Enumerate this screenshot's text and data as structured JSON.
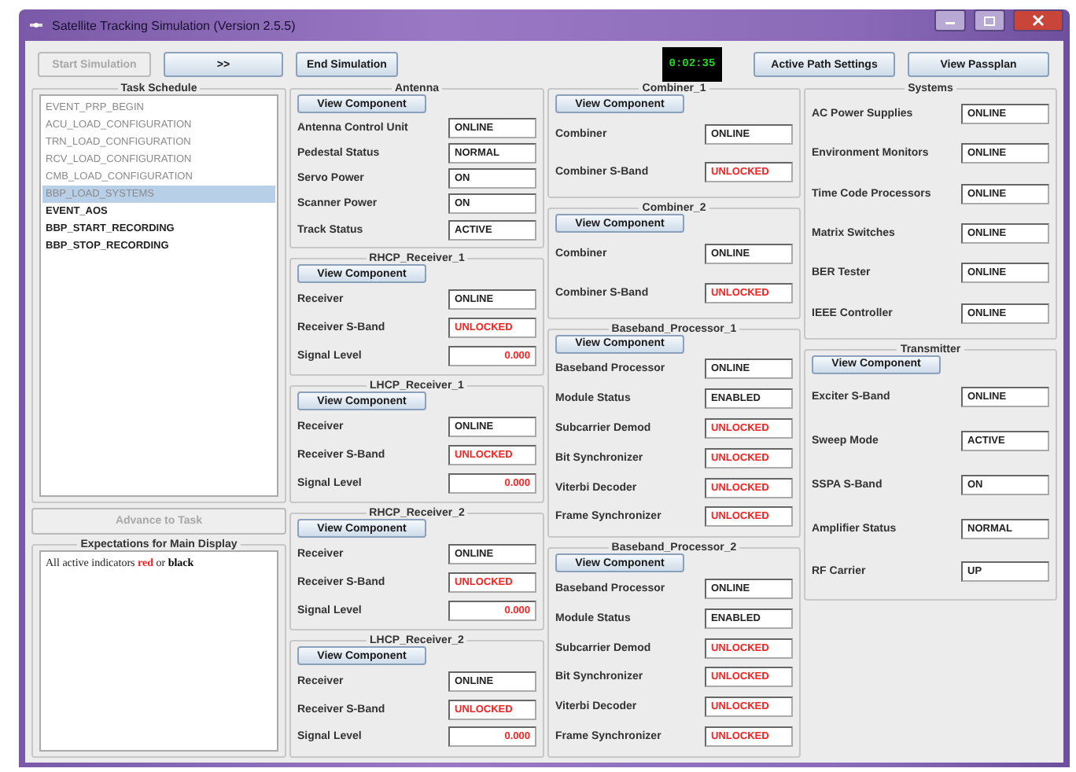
{
  "window": {
    "title": "Satellite Tracking Simulation (Version 2.5.5)"
  },
  "toolbar": {
    "left_buttons": [
      {
        "label": "Start Simulation",
        "disabled": true
      },
      {
        "label": ">>",
        "disabled": false
      },
      {
        "label": "End Simulation",
        "disabled": false
      }
    ],
    "clock": "0:02:35",
    "right_buttons": [
      {
        "label": "Active Path Settings",
        "disabled": false
      },
      {
        "label": "View Passplan",
        "disabled": false
      }
    ]
  },
  "task_schedule": {
    "title": "Task Schedule",
    "items": [
      {
        "label": "EVENT_PRP_BEGIN",
        "completed": true,
        "selected": false
      },
      {
        "label": "ACU_LOAD_CONFIGURATION",
        "completed": true,
        "selected": false
      },
      {
        "label": "TRN_LOAD_CONFIGURATION",
        "completed": true,
        "selected": false
      },
      {
        "label": "RCV_LOAD_CONFIGURATION",
        "completed": true,
        "selected": false
      },
      {
        "label": "CMB_LOAD_CONFIGURATION",
        "completed": true,
        "selected": false
      },
      {
        "label": "BBP_LOAD_SYSTEMS",
        "completed": true,
        "selected": true
      },
      {
        "label": "EVENT_AOS",
        "completed": false,
        "selected": false
      },
      {
        "label": "BBP_START_RECORDING",
        "completed": false,
        "selected": false
      },
      {
        "label": "BBP_STOP_RECORDING",
        "completed": false,
        "selected": false
      }
    ],
    "advance_button": {
      "label": "Advance to Task",
      "disabled": true
    }
  },
  "expectations": {
    "title": "Expectations for Main Display",
    "segments": [
      {
        "text": "All active indicators ",
        "kind": "plain"
      },
      {
        "text": "red",
        "kind": "red"
      },
      {
        "text": " or ",
        "kind": "plain"
      },
      {
        "text": "black",
        "kind": "bold"
      }
    ]
  },
  "columns": [
    [
      {
        "title": "Antenna",
        "button": "View Component",
        "fields": [
          {
            "label": "Antenna Control Unit",
            "value": "ONLINE",
            "alert": false,
            "kind": "status"
          },
          {
            "label": "Pedestal Status",
            "value": "NORMAL",
            "alert": false,
            "kind": "status"
          },
          {
            "label": "Servo Power",
            "value": "ON",
            "alert": false,
            "kind": "status"
          },
          {
            "label": "Scanner Power",
            "value": "ON",
            "alert": false,
            "kind": "status"
          },
          {
            "label": "Track Status",
            "value": "ACTIVE",
            "alert": false,
            "kind": "status"
          }
        ]
      },
      {
        "title": "RHCP_Receiver_1",
        "button": "View Component",
        "fields": [
          {
            "label": "Receiver",
            "value": "ONLINE",
            "alert": false,
            "kind": "status"
          },
          {
            "label": "Receiver S-Band",
            "value": "UNLOCKED",
            "alert": true,
            "kind": "status"
          },
          {
            "label": "Signal Level",
            "value": "0.000",
            "alert": true,
            "kind": "reading"
          }
        ]
      },
      {
        "title": "LHCP_Receiver_1",
        "button": "View Component",
        "fields": [
          {
            "label": "Receiver",
            "value": "ONLINE",
            "alert": false,
            "kind": "status"
          },
          {
            "label": "Receiver S-Band",
            "value": "UNLOCKED",
            "alert": true,
            "kind": "status"
          },
          {
            "label": "Signal Level",
            "value": "0.000",
            "alert": true,
            "kind": "reading"
          }
        ]
      },
      {
        "title": "RHCP_Receiver_2",
        "button": "View Component",
        "fields": [
          {
            "label": "Receiver",
            "value": "ONLINE",
            "alert": false,
            "kind": "status"
          },
          {
            "label": "Receiver S-Band",
            "value": "UNLOCKED",
            "alert": true,
            "kind": "status"
          },
          {
            "label": "Signal Level",
            "value": "0.000",
            "alert": true,
            "kind": "reading"
          }
        ]
      },
      {
        "title": "LHCP_Receiver_2",
        "button": "View Component",
        "fields": [
          {
            "label": "Receiver",
            "value": "ONLINE",
            "alert": false,
            "kind": "status"
          },
          {
            "label": "Receiver S-Band",
            "value": "UNLOCKED",
            "alert": true,
            "kind": "status"
          },
          {
            "label": "Signal Level",
            "value": "0.000",
            "alert": true,
            "kind": "reading"
          }
        ]
      }
    ],
    [
      {
        "title": "Combiner_1",
        "button": "View Component",
        "fields": [
          {
            "label": "Combiner",
            "value": "ONLINE",
            "alert": false,
            "kind": "status"
          },
          {
            "label": "Combiner S-Band",
            "value": "UNLOCKED",
            "alert": true,
            "kind": "status"
          }
        ]
      },
      {
        "title": "Combiner_2",
        "button": "View Component",
        "fields": [
          {
            "label": "Combiner",
            "value": "ONLINE",
            "alert": false,
            "kind": "status"
          },
          {
            "label": "Combiner S-Band",
            "value": "UNLOCKED",
            "alert": true,
            "kind": "status"
          }
        ]
      },
      {
        "title": "Baseband_Processor_1",
        "button": "View Component",
        "fields": [
          {
            "label": "Baseband Processor",
            "value": "ONLINE",
            "alert": false,
            "kind": "status"
          },
          {
            "label": "Module Status",
            "value": "ENABLED",
            "alert": false,
            "kind": "status"
          },
          {
            "label": "Subcarrier Demod",
            "value": "UNLOCKED",
            "alert": true,
            "kind": "status"
          },
          {
            "label": "Bit Synchronizer",
            "value": "UNLOCKED",
            "alert": true,
            "kind": "status"
          },
          {
            "label": "Viterbi Decoder",
            "value": "UNLOCKED",
            "alert": true,
            "kind": "status"
          },
          {
            "label": "Frame Synchronizer",
            "value": "UNLOCKED",
            "alert": true,
            "kind": "status"
          }
        ]
      },
      {
        "title": "Baseband_Processor_2",
        "button": "View Component",
        "fields": [
          {
            "label": "Baseband Processor",
            "value": "ONLINE",
            "alert": false,
            "kind": "status"
          },
          {
            "label": "Module Status",
            "value": "ENABLED",
            "alert": false,
            "kind": "status"
          },
          {
            "label": "Subcarrier Demod",
            "value": "UNLOCKED",
            "alert": true,
            "kind": "status"
          },
          {
            "label": "Bit Synchronizer",
            "value": "UNLOCKED",
            "alert": true,
            "kind": "status"
          },
          {
            "label": "Viterbi Decoder",
            "value": "UNLOCKED",
            "alert": true,
            "kind": "status"
          },
          {
            "label": "Frame Synchronizer",
            "value": "UNLOCKED",
            "alert": true,
            "kind": "status"
          }
        ]
      }
    ],
    [
      {
        "title": "Systems",
        "fields": [
          {
            "label": "AC Power Supplies",
            "value": "ONLINE",
            "alert": false,
            "kind": "status"
          },
          {
            "label": "Environment Monitors",
            "value": "ONLINE",
            "alert": false,
            "kind": "status"
          },
          {
            "label": "Time Code Processors",
            "value": "ONLINE",
            "alert": false,
            "kind": "status"
          },
          {
            "label": "Matrix Switches",
            "value": "ONLINE",
            "alert": false,
            "kind": "status"
          },
          {
            "label": "BER Tester",
            "value": "ONLINE",
            "alert": false,
            "kind": "status"
          },
          {
            "label": "IEEE Controller",
            "value": "ONLINE",
            "alert": false,
            "kind": "status"
          }
        ]
      },
      {
        "title": "Transmitter",
        "button": "View Component",
        "fields": [
          {
            "label": "Exciter S-Band",
            "value": "ONLINE",
            "alert": false,
            "kind": "status"
          },
          {
            "label": "Sweep Mode",
            "value": "ACTIVE",
            "alert": false,
            "kind": "status"
          },
          {
            "label": "SSPA S-Band",
            "value": "ON",
            "alert": false,
            "kind": "status"
          },
          {
            "label": "Amplifier Status",
            "value": "NORMAL",
            "alert": false,
            "kind": "status"
          },
          {
            "label": "RF Carrier",
            "value": "UP",
            "alert": false,
            "kind": "status"
          }
        ]
      }
    ]
  ]
}
